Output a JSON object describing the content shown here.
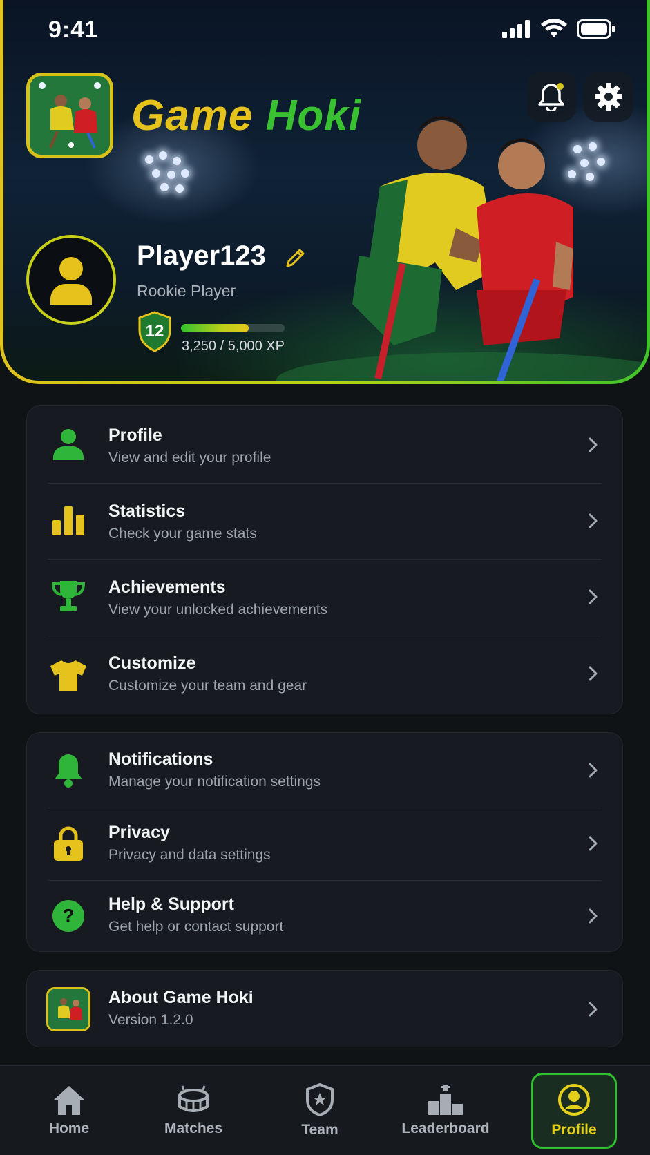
{
  "status_bar": {
    "time": "9:41"
  },
  "header": {
    "title_part1": "Game",
    "title_part2": "Hoki"
  },
  "profile": {
    "username": "Player123",
    "rank": "Rookie Player",
    "level": "12",
    "xp_text": "3,250 / 5,000 XP",
    "xp_progress": 0.65
  },
  "menu_main": [
    {
      "title": "Profile",
      "subtitle": "View and edit your profile",
      "icon": "person-icon"
    },
    {
      "title": "Statistics",
      "subtitle": "Check your game stats",
      "icon": "bar-chart-icon"
    },
    {
      "title": "Achievements",
      "subtitle": "View your unlocked achievements",
      "icon": "trophy-icon"
    },
    {
      "title": "Customize",
      "subtitle": "Customize your team and gear",
      "icon": "jersey-icon"
    }
  ],
  "menu_settings": [
    {
      "title": "Notifications",
      "subtitle": "Manage your notification settings",
      "icon": "bell-icon"
    },
    {
      "title": "Privacy",
      "subtitle": "Privacy and data settings",
      "icon": "lock-icon"
    },
    {
      "title": "Help & Support",
      "subtitle": "Get help or contact support",
      "icon": "help-icon"
    }
  ],
  "about": {
    "title": "About Game Hoki",
    "subtitle": "Version 1.2.0"
  },
  "bottom_nav": [
    {
      "label": "Home",
      "icon": "home-icon"
    },
    {
      "label": "Matches",
      "icon": "stadium-icon"
    },
    {
      "label": "Team",
      "icon": "shield-star-icon"
    },
    {
      "label": "Leaderboard",
      "icon": "podium-icon"
    },
    {
      "label": "Profile",
      "icon": "profile-circle-icon",
      "active": true
    }
  ],
  "colors": {
    "accent_yellow": "#e6c21c",
    "accent_green": "#39c132",
    "background": "#101316",
    "card": "#171b21"
  }
}
